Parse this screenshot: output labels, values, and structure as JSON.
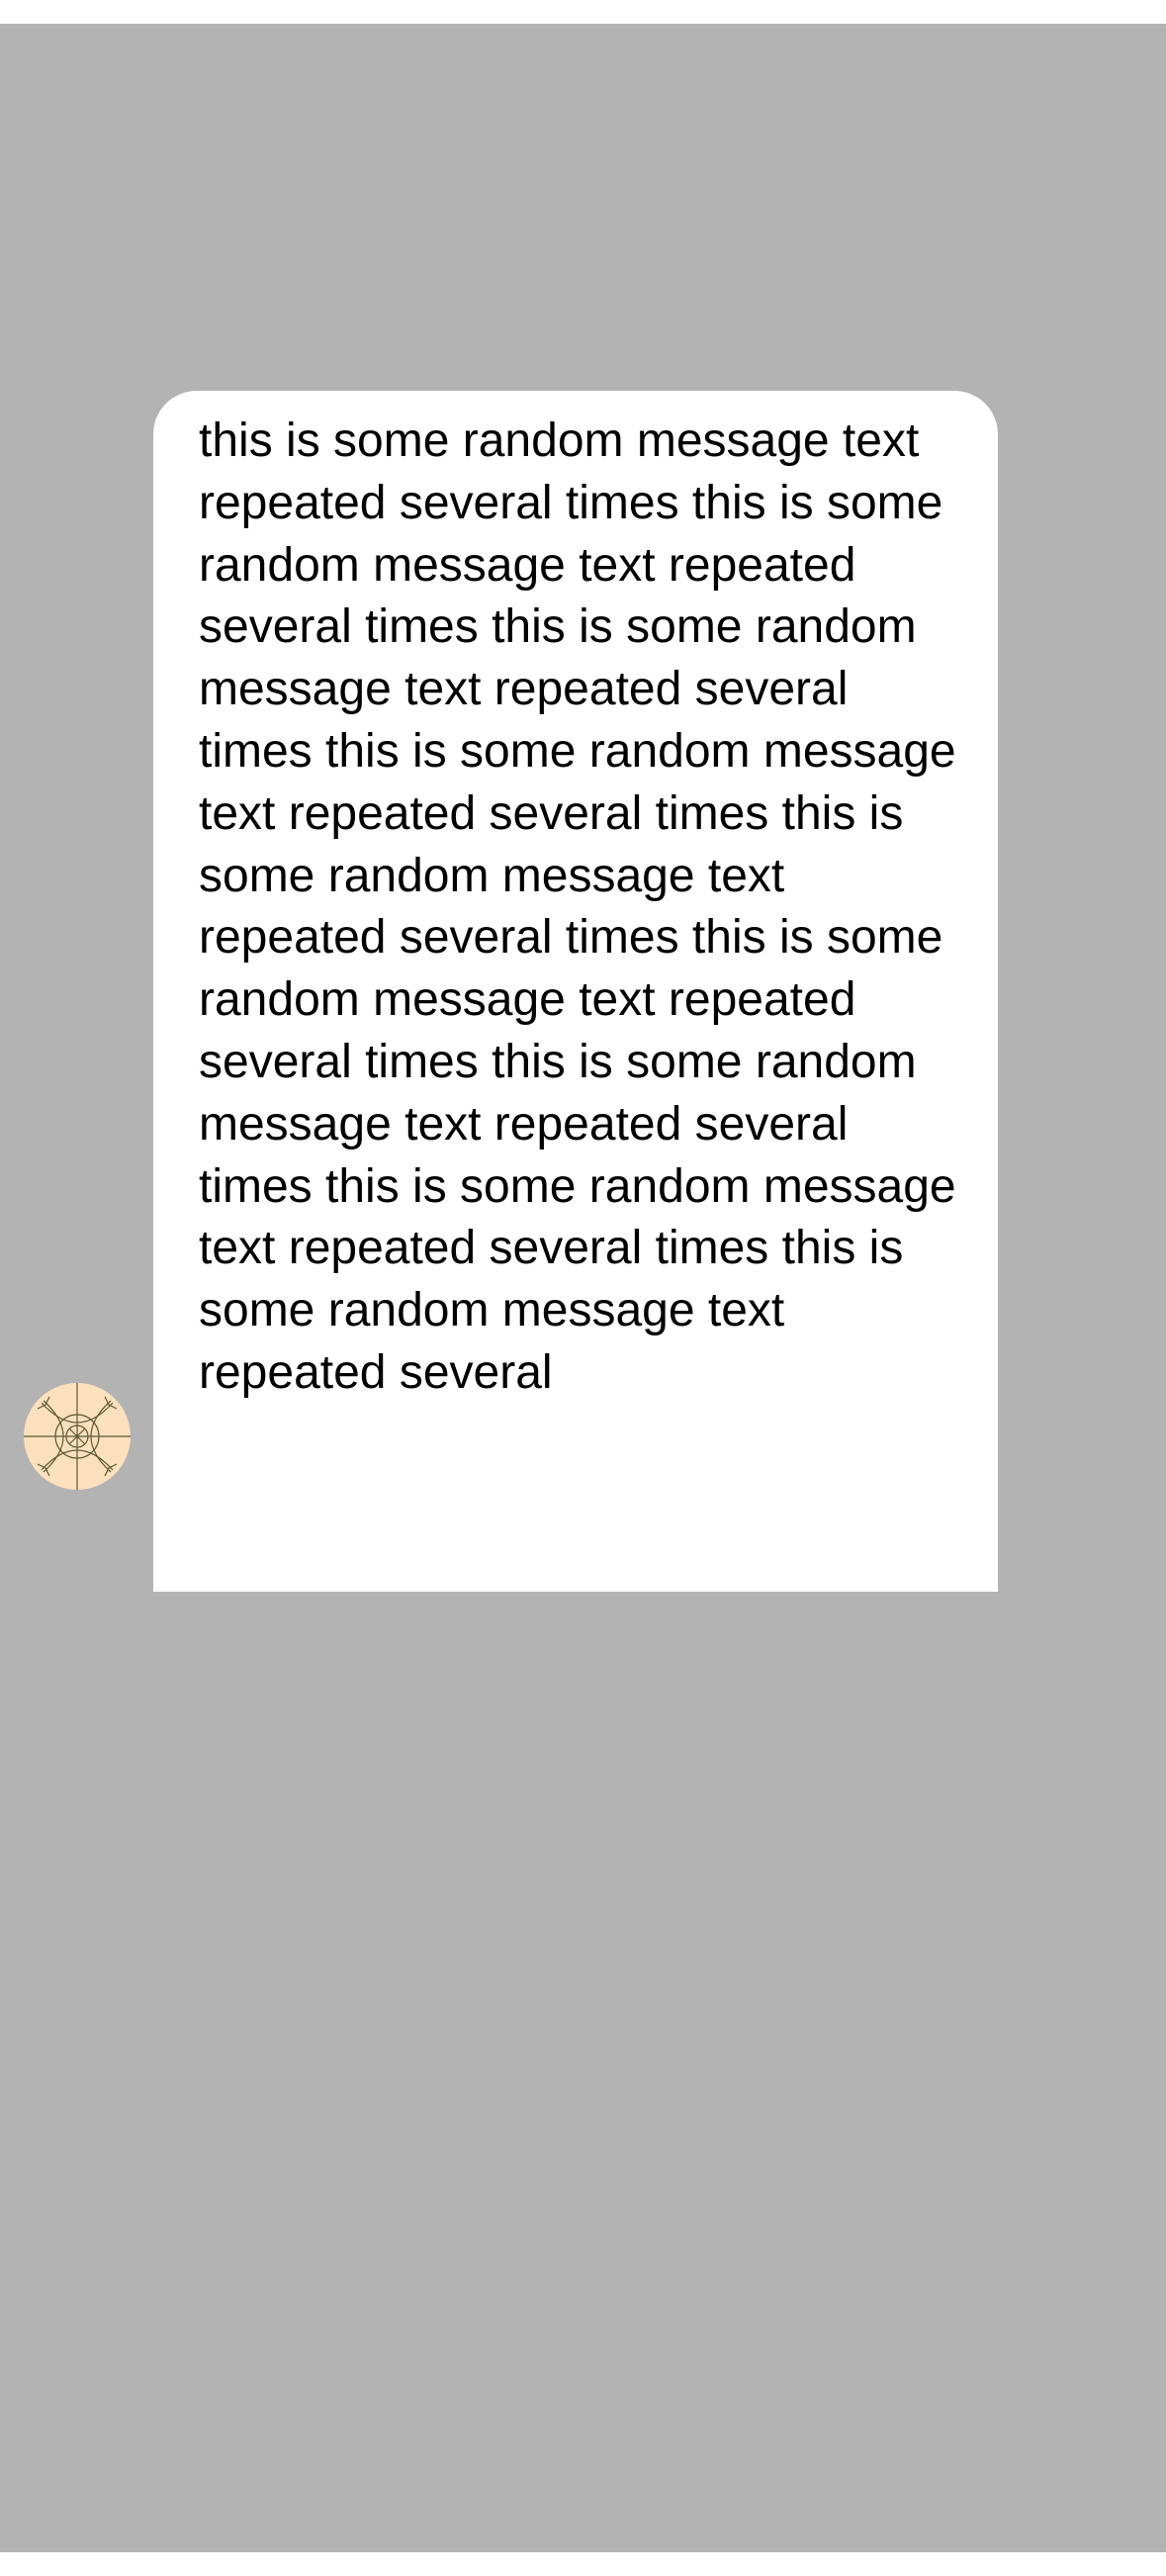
{
  "message": {
    "text": "this is some random message text repeated several times this is some random message text repeated several times this is some random message text repeated several times this is some random message text repeated several times this is some random message text repeated several times this is some random message text repeated several times this is some random message text repeated several times this is some random message text repeated several times this is some random message text repeated several",
    "bubble_color": "#ffffff",
    "text_color": "#000000"
  },
  "avatar": {
    "icon": "geometric-pattern-avatar-icon",
    "background_color": "#fde0bd",
    "line_color": "#5a5a33"
  },
  "overlay": {
    "color": "#b3b3b3"
  }
}
